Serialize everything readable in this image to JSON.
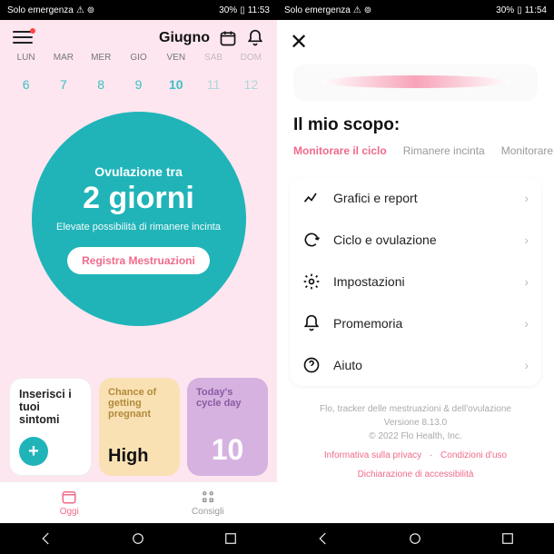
{
  "status": {
    "carrier": "Solo emergenza",
    "battery": "30%",
    "time_left": "11:53",
    "time_right": "11:54"
  },
  "left": {
    "month": "Giugno",
    "weekdays": [
      "LUN",
      "MAR",
      "MER",
      "GIO",
      "VEN",
      "SAB",
      "DOM"
    ],
    "days": [
      "6",
      "7",
      "8",
      "9",
      "10",
      "11",
      "12"
    ],
    "ovulation": {
      "label": "Ovulazione tra",
      "value": "2 giorni",
      "subtitle": "Elevate possibilità di rimanere incinta",
      "button": "Registra Mestruazioni"
    },
    "cards": {
      "symptoms": {
        "title": "Inserisci i tuoi sintomi"
      },
      "chance": {
        "title": "Chance of getting pregnant",
        "value": "High"
      },
      "cycleday": {
        "title": "Today's cycle day",
        "value": "10"
      }
    },
    "nav": {
      "today": "Oggi",
      "advice": "Consigli"
    }
  },
  "right": {
    "scope_title": "Il mio scopo:",
    "tabs": {
      "track": "Monitorare il ciclo",
      "pregnant": "Rimanere incinta",
      "more": "Monitorare"
    },
    "menu": {
      "charts": "Grafici e report",
      "cycle": "Ciclo e ovulazione",
      "settings": "Impostazioni",
      "reminders": "Promemoria",
      "help": "Aiuto"
    },
    "footer": {
      "line1": "Flo, tracker delle mestruazioni & dell'ovulazione",
      "line2": "Versione 8.13.0",
      "line3": "© 2022 Flo Health, Inc.",
      "privacy": "Informativa sulla privacy",
      "dot": "·",
      "terms": "Condizioni d'uso",
      "a11y": "Dichiarazione di accessibilità"
    }
  }
}
